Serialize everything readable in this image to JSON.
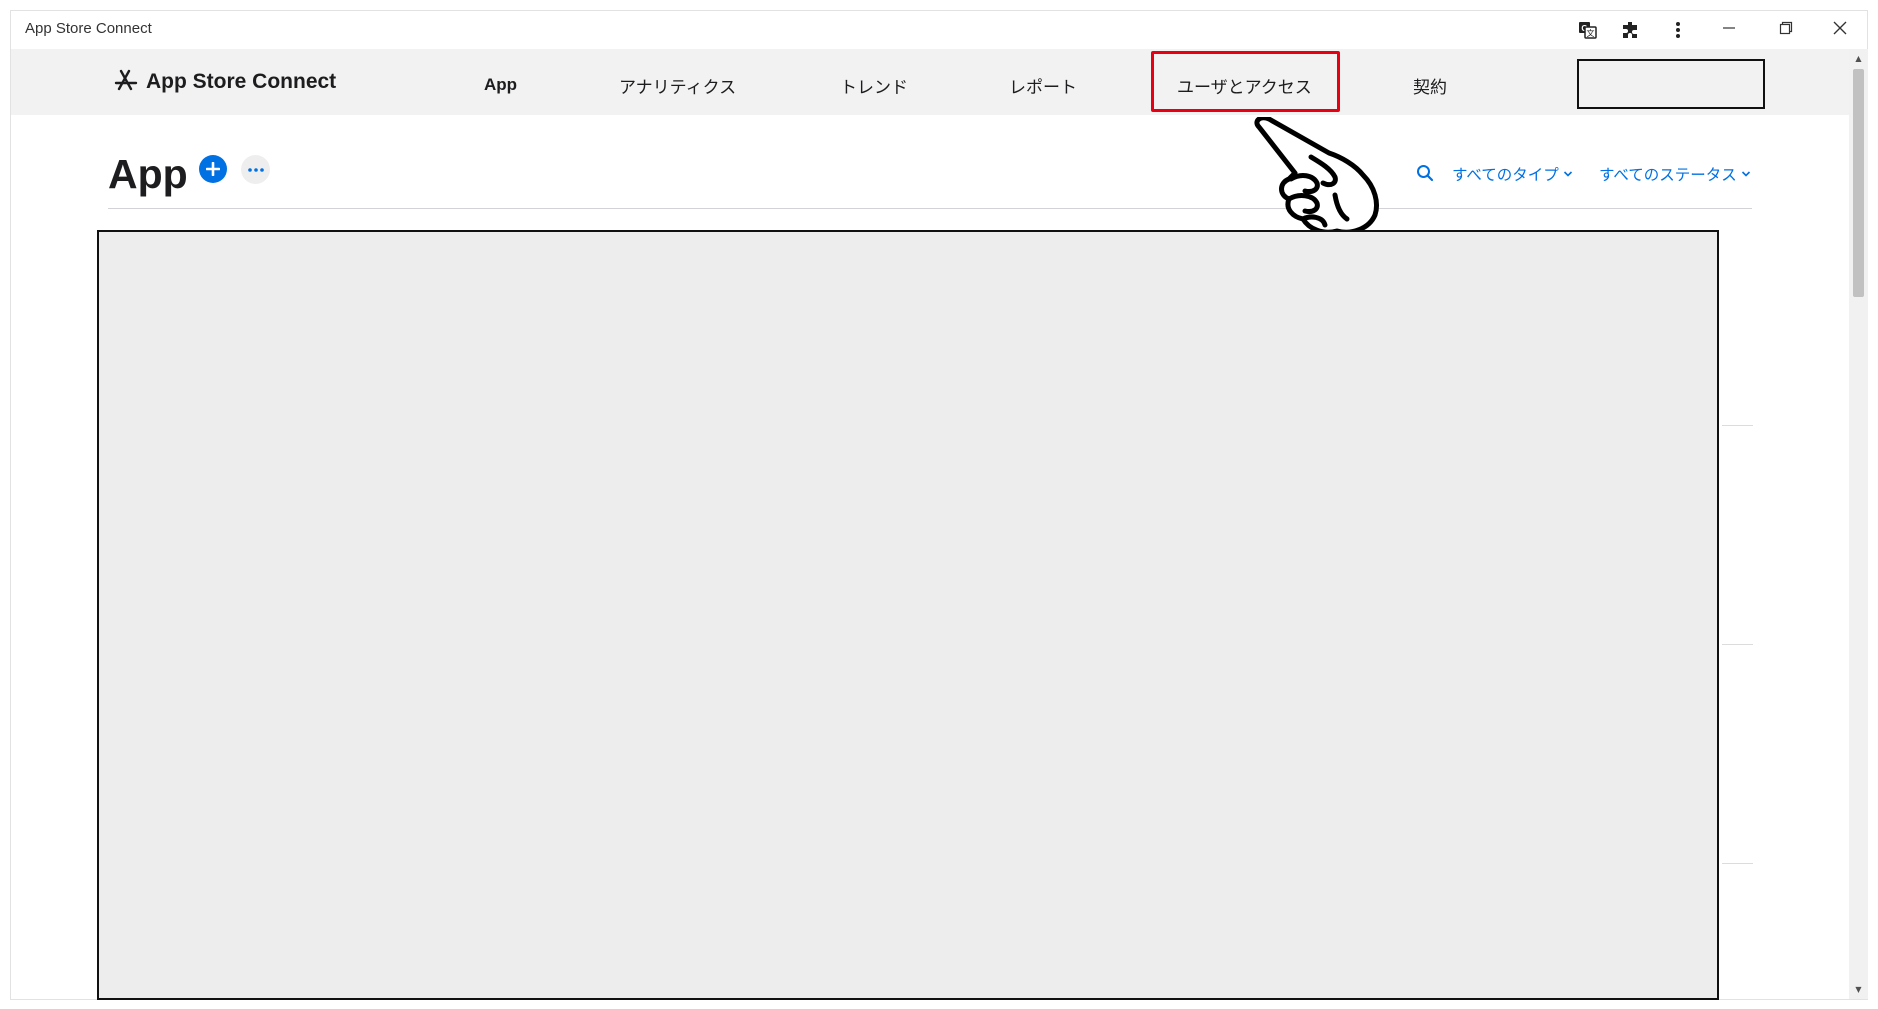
{
  "window": {
    "title": "App Store Connect"
  },
  "browser_toolbar": {
    "icons": [
      "translate-icon",
      "extensions-icon",
      "menu-kebab-icon"
    ],
    "controls": [
      "minimize-icon",
      "restore-icon",
      "close-icon"
    ]
  },
  "nav": {
    "brand": "App Store Connect",
    "items": [
      {
        "label": "App"
      },
      {
        "label": "アナリティクス"
      },
      {
        "label": "トレンド"
      },
      {
        "label": "レポート"
      },
      {
        "label": "ユーザとアクセス"
      },
      {
        "label": "契約"
      }
    ],
    "highlighted_item": "ユーザとアクセス",
    "highlight_color": "#e60012"
  },
  "page": {
    "title": "App",
    "filters": {
      "type": "すべてのタイプ",
      "status": "すべてのステータス"
    }
  },
  "colors": {
    "accent": "#0071e3",
    "nav_background": "#f2f2f2",
    "content_placeholder": "#ededed"
  }
}
